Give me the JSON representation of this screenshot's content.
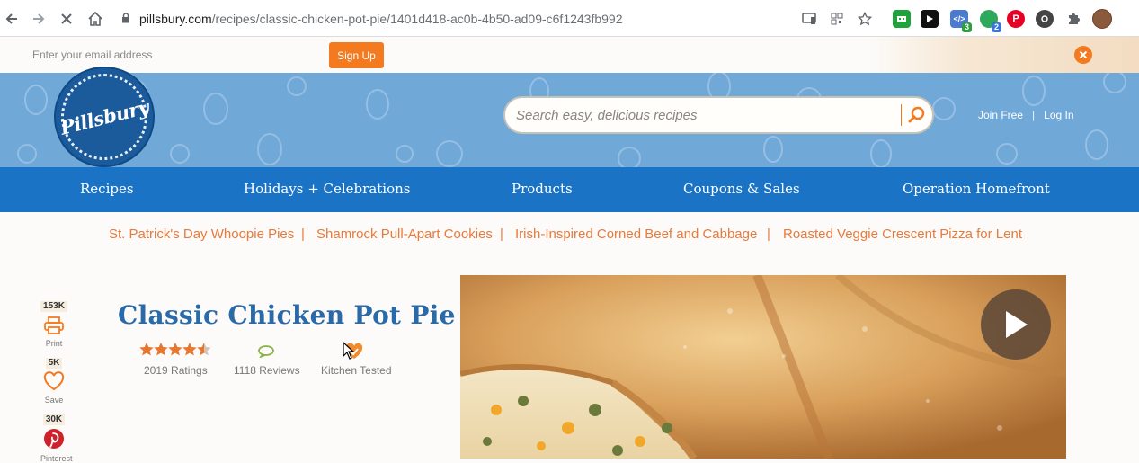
{
  "browser": {
    "url_host": "pillsbury.com",
    "url_path": "/recipes/classic-chicken-pot-pie/1401d418-ac0b-4b50-ad09-c6f1243fb992",
    "extensions": [
      {
        "name": "ext-green-icon",
        "color": "#20a33a",
        "badge": ""
      },
      {
        "name": "ext-play-icon",
        "color": "#111111",
        "badge": ""
      },
      {
        "name": "ext-code-icon",
        "color": "#4a7bd0",
        "badge": "3",
        "badge_color": "#2e9e3f"
      },
      {
        "name": "ext-chat-icon",
        "color": "#2ea85a",
        "badge": "2",
        "badge_color": "#3b74d6"
      },
      {
        "name": "pinterest-ext-icon",
        "color": "#e60023",
        "badge": ""
      },
      {
        "name": "ext-camera-icon",
        "color": "#444444",
        "badge": ""
      }
    ]
  },
  "email_bar": {
    "placeholder": "Enter your email address",
    "signup_label": "Sign Up"
  },
  "header": {
    "logo_text": "Pillsbury",
    "search_placeholder": "Search easy, delicious recipes",
    "join_label": "Join Free",
    "separator": "|",
    "login_label": "Log In"
  },
  "nav": {
    "items": [
      "Recipes",
      "Holidays + Celebrations",
      "Products",
      "Coupons & Sales",
      "Operation Homefront"
    ]
  },
  "trending": {
    "links": [
      "St. Patrick's Day Whoopie Pies",
      "Shamrock Pull-Apart Cookies",
      "Irish-Inspired Corned Beef and Cabbage",
      "Roasted Veggie Crescent Pizza for Lent"
    ],
    "separator": "|"
  },
  "share": {
    "print": {
      "count": "153K",
      "label": "Print"
    },
    "save": {
      "count": "5K",
      "label": "Save"
    },
    "pinterest": {
      "count": "30K",
      "label": "Pinterest"
    }
  },
  "recipe": {
    "title": "Classic Chicken Pot Pie",
    "rating_stars": 4.5,
    "ratings_label": "2019 Ratings",
    "reviews_label": "1118 Reviews",
    "kitchen_label": "Kitchen Tested"
  },
  "colors": {
    "brand_blue": "#1a73c5",
    "header_blue": "#70a8d8",
    "accent_orange": "#f47a20",
    "title_blue": "#2a6aa8"
  }
}
